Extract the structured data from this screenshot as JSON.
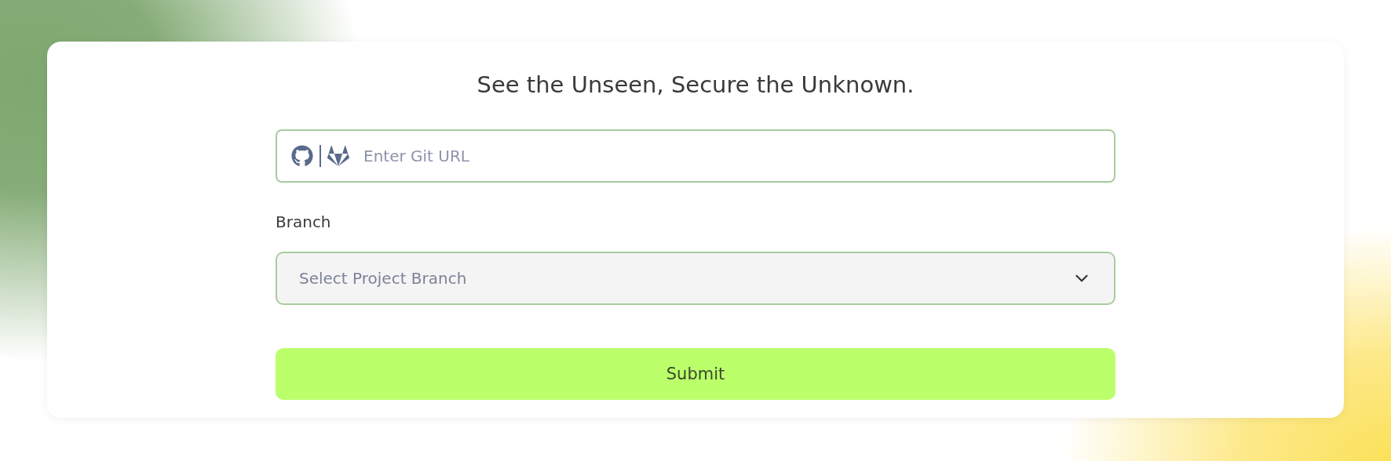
{
  "heading": "See the Unseen, Secure the Unknown.",
  "git_url": {
    "placeholder": "Enter Git URL"
  },
  "branch": {
    "label": "Branch",
    "placeholder": "Select Project Branch"
  },
  "submit": "Submit"
}
